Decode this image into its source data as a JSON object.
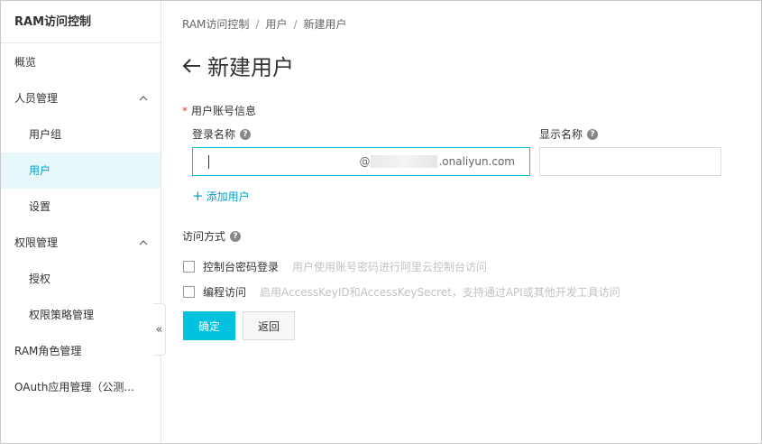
{
  "sidebar": {
    "title": "RAM访问控制",
    "items": [
      {
        "label": "概览"
      },
      {
        "label": "人员管理"
      },
      {
        "label": "用户组"
      },
      {
        "label": "用户"
      },
      {
        "label": "设置"
      },
      {
        "label": "权限管理"
      },
      {
        "label": "授权"
      },
      {
        "label": "权限策略管理"
      },
      {
        "label": "RAM角色管理"
      },
      {
        "label": "OAuth应用管理（公测..."
      }
    ],
    "collapse_glyph": "«"
  },
  "breadcrumb": [
    "RAM访问控制",
    "用户",
    "新建用户"
  ],
  "breadcrumb_sep": "/",
  "page_title": "新建用户",
  "form": {
    "required_mark": "*",
    "section_label": "用户账号信息",
    "login_name_label": "登录名称",
    "login_name_value": "",
    "domain_at": "@",
    "domain_suffix": ".onaliyun.com",
    "display_name_label": "显示名称",
    "display_name_value": "",
    "help_glyph": "?",
    "add_user_plus": "+",
    "add_user_label": "添加用户",
    "access_label": "访问方式",
    "options": [
      {
        "label": "控制台密码登录",
        "description": "用户使用账号密码进行阿里云控制台访问",
        "checked": false
      },
      {
        "label": "编程访问",
        "description": "启用AccessKeyID和AccessKeySecret，支持通过API或其他开发工具访问",
        "checked": false
      }
    ],
    "confirm_label": "确定",
    "back_label": "返回"
  },
  "colors": {
    "accent": "#00c1de",
    "link": "#00a2ca",
    "active_bg": "#e8f7fa"
  }
}
